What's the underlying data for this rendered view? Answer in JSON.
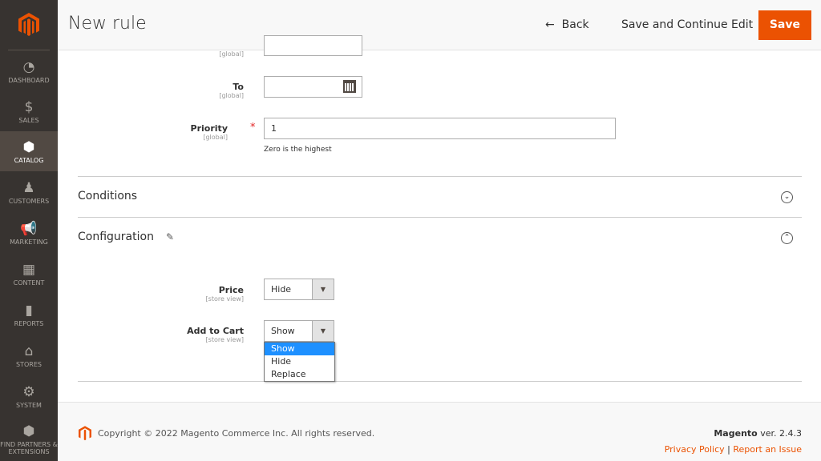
{
  "sidebar": {
    "items": [
      {
        "label": "Dashboard",
        "icon": "dashboard-icon",
        "glyph": "◔"
      },
      {
        "label": "Sales",
        "icon": "dollar-icon",
        "glyph": "$"
      },
      {
        "label": "Catalog",
        "icon": "box-icon",
        "glyph": "⬢",
        "active": true
      },
      {
        "label": "Customers",
        "icon": "person-icon",
        "glyph": "♟"
      },
      {
        "label": "Marketing",
        "icon": "megaphone-icon",
        "glyph": "📢"
      },
      {
        "label": "Content",
        "icon": "layout-icon",
        "glyph": "▦"
      },
      {
        "label": "Reports",
        "icon": "bar-chart-icon",
        "glyph": "▮"
      },
      {
        "label": "Stores",
        "icon": "store-icon",
        "glyph": "⌂"
      },
      {
        "label": "System",
        "icon": "gear-icon",
        "glyph": "⚙"
      },
      {
        "label": "Find Partners & Extensions",
        "icon": "blocks-icon",
        "glyph": "⬢"
      }
    ]
  },
  "header": {
    "title": "New rule",
    "back": "Back",
    "back_icon": "←",
    "save_continue": "Save and Continue Edit",
    "save": "Save"
  },
  "form": {
    "from_scope": "[global]",
    "to": {
      "label": "To",
      "scope": "[global]",
      "value": ""
    },
    "priority": {
      "label": "Priority",
      "scope": "[global]",
      "required": "*",
      "value": "1",
      "note": "Zero is the highest"
    }
  },
  "sections": {
    "conditions": "Conditions",
    "configuration": "Configuration"
  },
  "config": {
    "price": {
      "label": "Price",
      "scope": "[store view]",
      "value": "Hide"
    },
    "add_to_cart": {
      "label": "Add to Cart",
      "scope": "[store view]",
      "value": "Show",
      "options": [
        "Show",
        "Hide",
        "Replace"
      ]
    }
  },
  "footer": {
    "copyright": "Copyright © 2022 Magento Commerce Inc. All rights reserved.",
    "brand": "Magento",
    "version": " ver. 2.4.3",
    "privacy": "Privacy Policy",
    "sep": "|",
    "report": "Report an Issue"
  },
  "colors": {
    "accent": "#eb5202",
    "sidebar": "#373330",
    "highlight": "#1e90ff"
  }
}
